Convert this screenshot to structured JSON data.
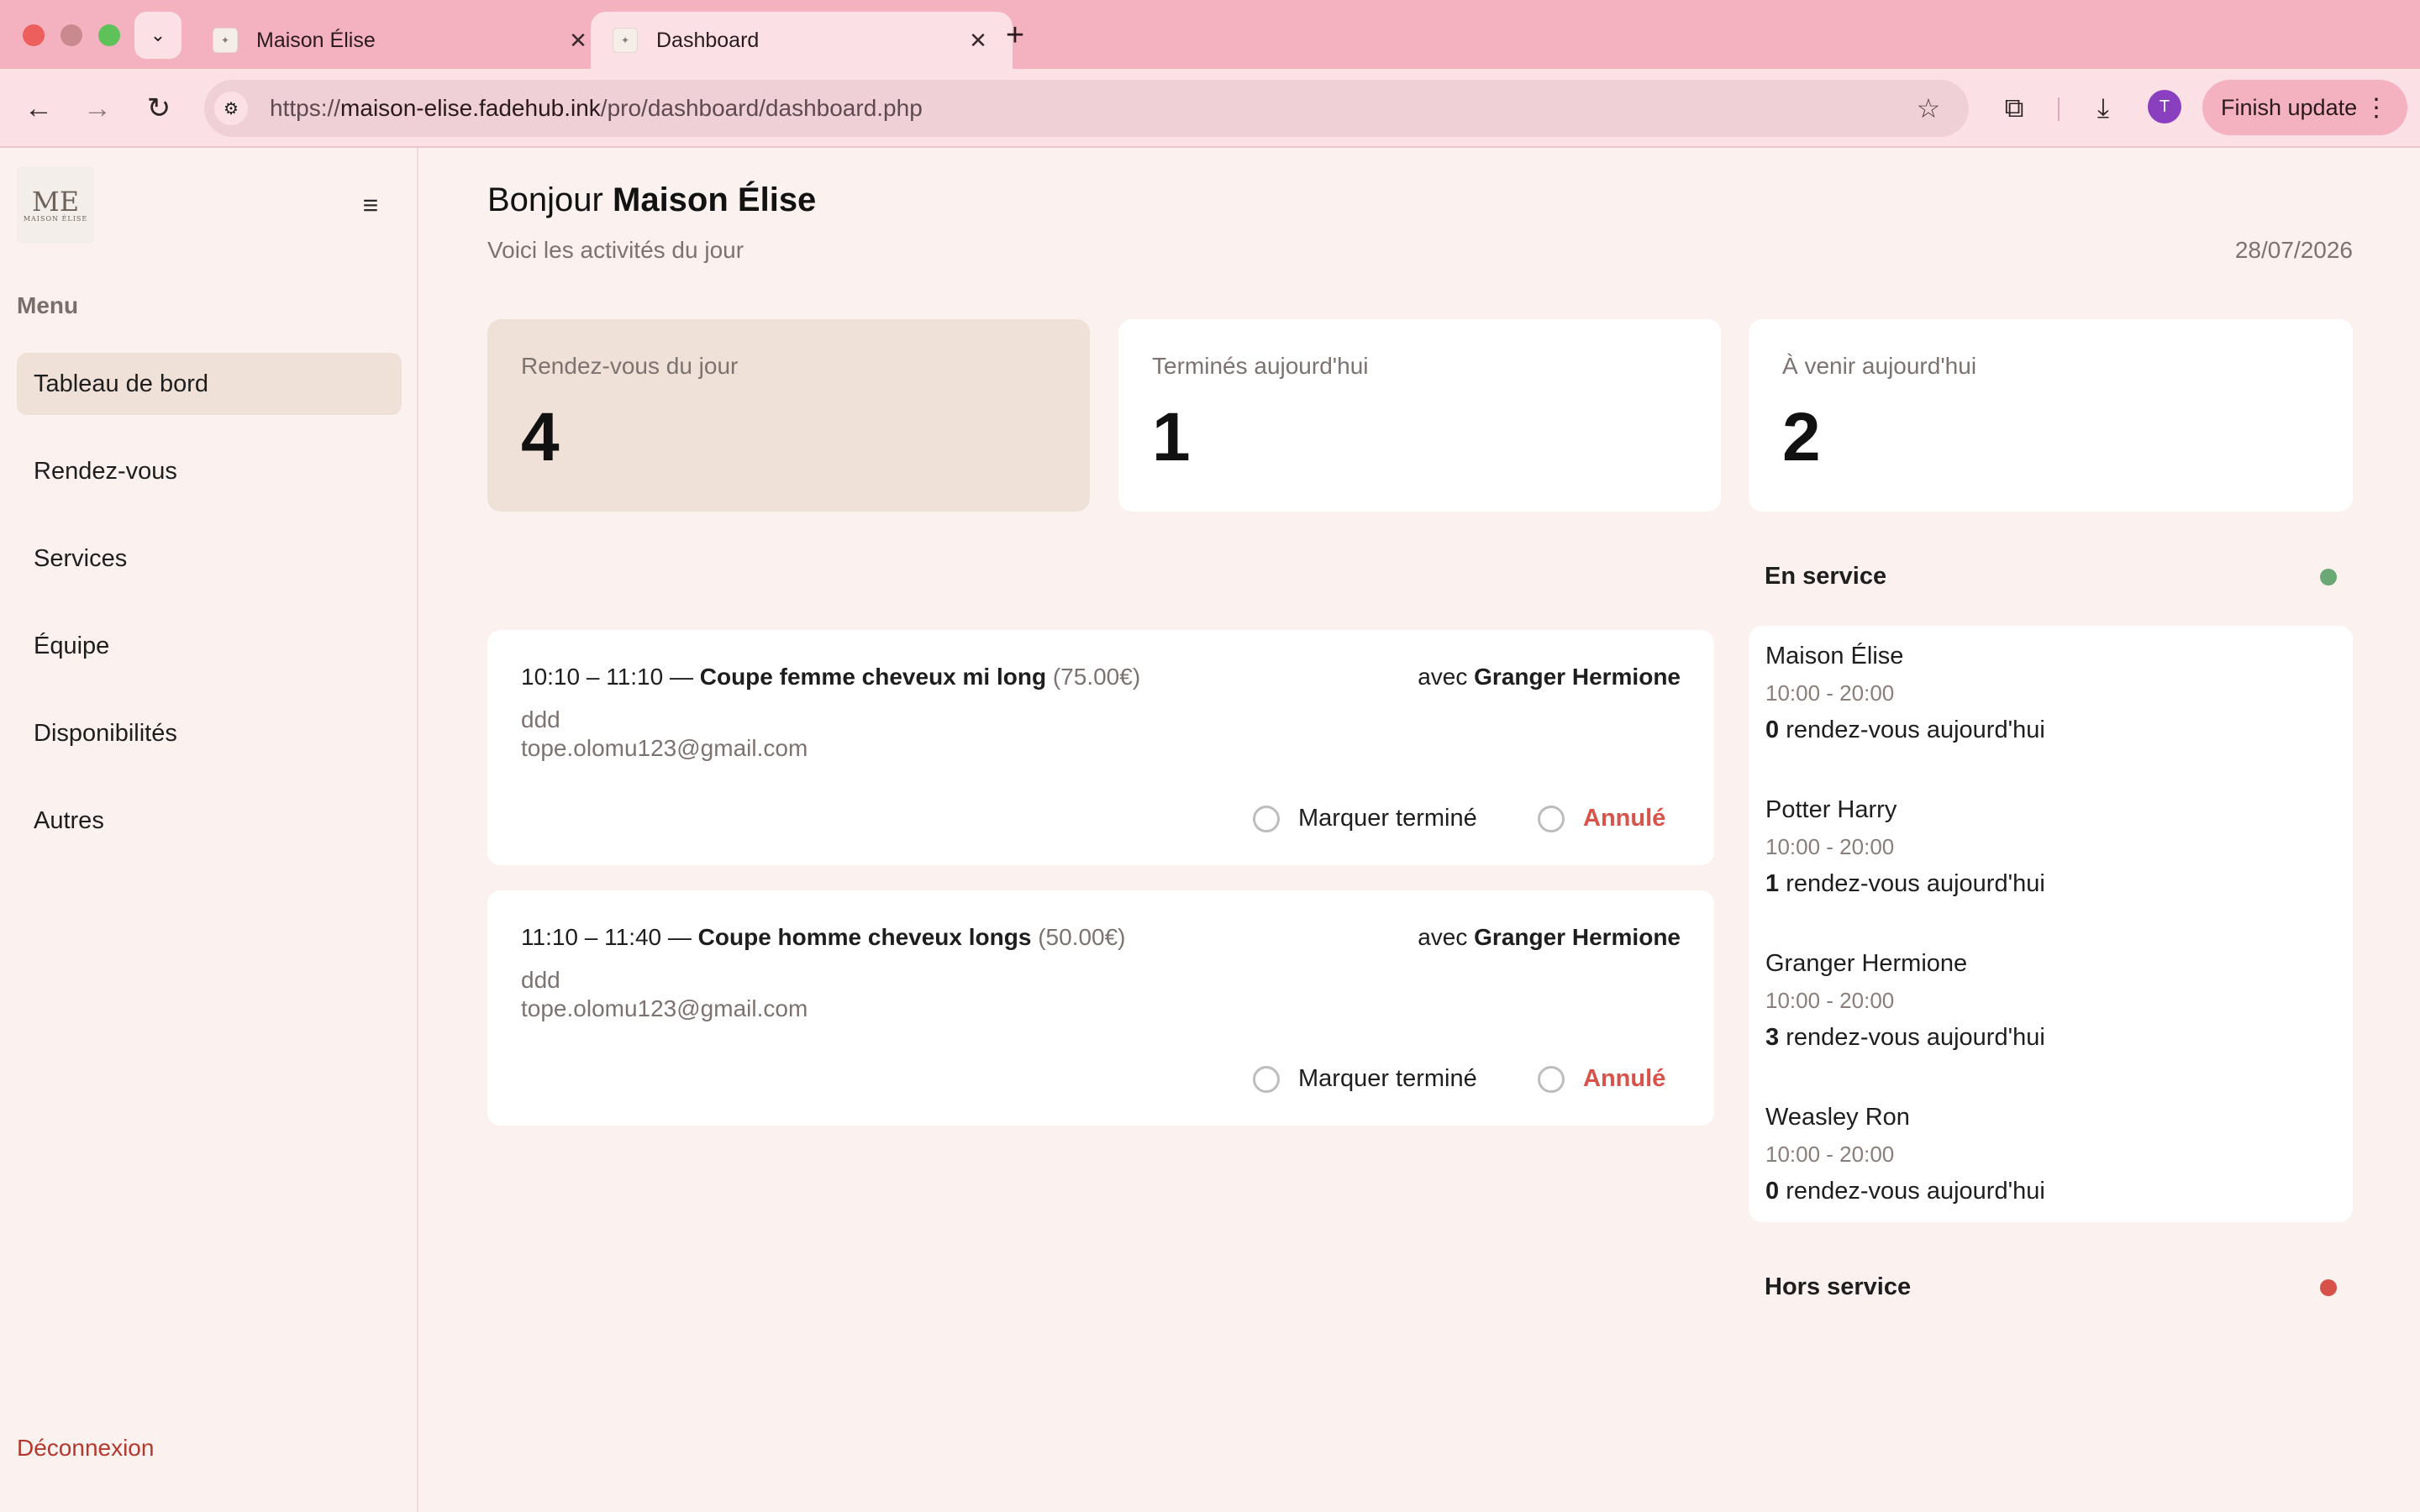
{
  "browser": {
    "tabs": [
      {
        "title": "Maison Élise",
        "active": false
      },
      {
        "title": "Dashboard",
        "active": true
      }
    ],
    "url_prefix": "https://",
    "url_host": "maison-elise.fadehub.ink",
    "url_path": "/pro/dashboard/dashboard.php",
    "profile_initial": "T",
    "finish_update_label": "Finish update"
  },
  "sidebar": {
    "logo_mono": "ME",
    "logo_text": "MAISON ÉLISE",
    "menu_label": "Menu",
    "items": [
      {
        "label": "Tableau de bord",
        "active": true
      },
      {
        "label": "Rendez-vous",
        "active": false
      },
      {
        "label": "Services",
        "active": false
      },
      {
        "label": "Équipe",
        "active": false
      },
      {
        "label": "Disponibilités",
        "active": false
      },
      {
        "label": "Autres",
        "active": false
      }
    ],
    "logout_label": "Déconnexion"
  },
  "header": {
    "greeting": "Bonjour",
    "salon_name": "Maison Élise",
    "subtitle": "Voici les activités du jour",
    "date": "28/07/2026"
  },
  "stats": [
    {
      "label": "Rendez-vous du jour",
      "value": "4"
    },
    {
      "label": "Terminés aujourd'hui",
      "value": "1"
    },
    {
      "label": "À venir aujourd'hui",
      "value": "2"
    }
  ],
  "appointments": [
    {
      "time": "10:10 – 11:10 —",
      "service": "Coupe femme cheveux mi long",
      "price": "(75.00€)",
      "avec": "avec",
      "staff": "Granger Hermione",
      "client_name": "ddd",
      "client_email": "tope.olomu123@gmail.com",
      "done_label": "Marquer terminé",
      "cancel_label": "Annulé"
    },
    {
      "time": "11:10 – 11:40 —",
      "service": "Coupe homme cheveux longs",
      "price": "(50.00€)",
      "avec": "avec",
      "staff": "Granger Hermione",
      "client_name": "ddd",
      "client_email": "tope.olomu123@gmail.com",
      "done_label": "Marquer terminé",
      "cancel_label": "Annulé"
    }
  ],
  "en_service": {
    "title": "En service",
    "status_color": "#6aa875",
    "staff": [
      {
        "name": "Maison Élise",
        "hours": "10:00 - 20:00",
        "count": "0",
        "count_suffix": "rendez-vous aujourd'hui"
      },
      {
        "name": "Potter Harry",
        "hours": "10:00 - 20:00",
        "count": "1",
        "count_suffix": "rendez-vous aujourd'hui"
      },
      {
        "name": "Granger Hermione",
        "hours": "10:00 - 20:00",
        "count": "3",
        "count_suffix": "rendez-vous aujourd'hui"
      },
      {
        "name": "Weasley Ron",
        "hours": "10:00 - 20:00",
        "count": "0",
        "count_suffix": "rendez-vous aujourd'hui"
      }
    ]
  },
  "hors_service": {
    "title": "Hors service",
    "status_color": "#d6514a"
  }
}
